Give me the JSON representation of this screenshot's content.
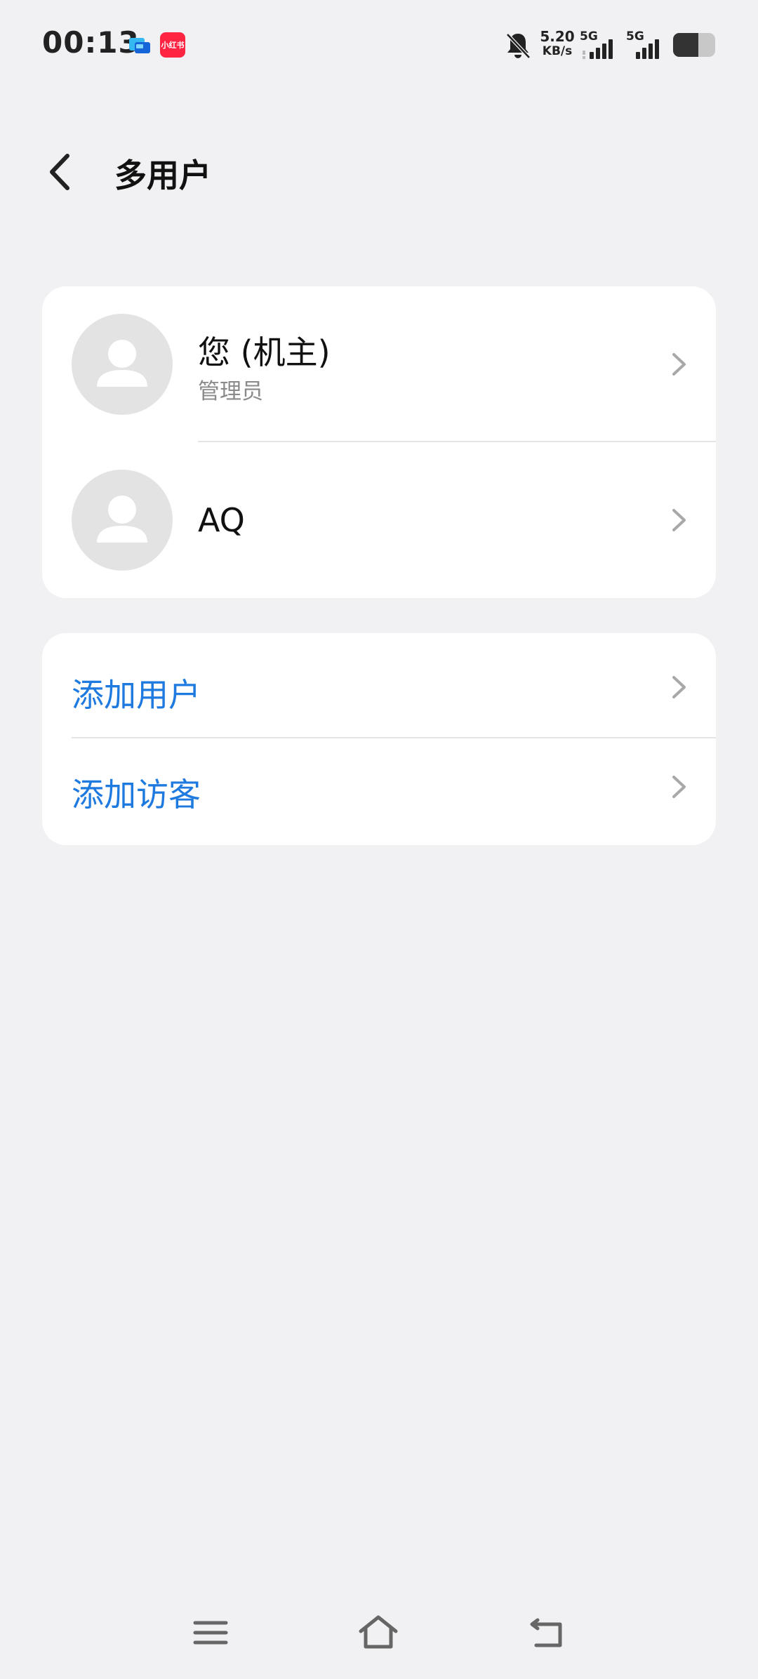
{
  "status_bar": {
    "time": "00:13",
    "app_icon_2_label": "小红书",
    "net_speed_value": "5.20",
    "net_speed_unit": "KB/s",
    "signal_1_label": "5G",
    "signal_2_label": "5G",
    "icons": [
      "chat-app-icon",
      "xiaohongshu-app-icon",
      "bell-muted-icon",
      "signal-icon",
      "signal-icon",
      "battery-icon"
    ]
  },
  "header": {
    "title": "多用户",
    "back_icon": "back-arrow-icon"
  },
  "users": [
    {
      "name": "您 (机主)",
      "role": "管理员",
      "avatar_icon": "person-icon"
    },
    {
      "name": "AQ",
      "role": "",
      "avatar_icon": "person-icon"
    }
  ],
  "actions": [
    {
      "label": "添加用户"
    },
    {
      "label": "添加访客"
    }
  ],
  "nav_bar": {
    "icons": [
      "menu-icon",
      "home-icon",
      "back-icon"
    ]
  },
  "colors": {
    "background": "#f1f1f3",
    "card": "#ffffff",
    "accent": "#1f7ae0",
    "secondary_text": "#8a8a8a",
    "avatar_bg": "#e3e3e3"
  }
}
